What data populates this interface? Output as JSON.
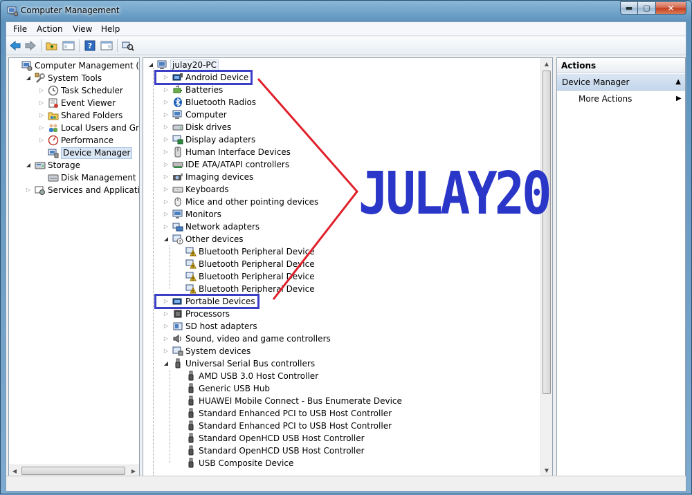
{
  "window": {
    "title": "Computer Management",
    "caption_min": "▬",
    "caption_max": "▢",
    "caption_close": "✕"
  },
  "menu": [
    "File",
    "Action",
    "View",
    "Help"
  ],
  "left_tree": [
    {
      "label": "Computer Management (Local",
      "icon": "computer-management-icon",
      "expander": ""
    },
    {
      "label": "System Tools",
      "icon": "system-tools-icon",
      "expander": "open"
    },
    {
      "label": "Task Scheduler",
      "icon": "clock-icon",
      "expander": "closed"
    },
    {
      "label": "Event Viewer",
      "icon": "event-viewer-icon",
      "expander": "closed"
    },
    {
      "label": "Shared Folders",
      "icon": "shared-folders-icon",
      "expander": "closed"
    },
    {
      "label": "Local Users and Groups",
      "icon": "users-icon",
      "expander": "closed"
    },
    {
      "label": "Performance",
      "icon": "performance-icon",
      "expander": "closed"
    },
    {
      "label": "Device Manager",
      "icon": "device-manager-icon",
      "expander": "",
      "selected": true
    },
    {
      "label": "Storage",
      "icon": "storage-icon",
      "expander": "open"
    },
    {
      "label": "Disk Management",
      "icon": "disk-management-icon",
      "expander": ""
    },
    {
      "label": "Services and Applications",
      "icon": "services-icon",
      "expander": "closed"
    }
  ],
  "device_tree": {
    "root": "julay20-PC",
    "items": [
      {
        "label": "Android Device",
        "icon": "android-device-icon",
        "level": 1,
        "expander": "closed"
      },
      {
        "label": "Batteries",
        "icon": "battery-icon",
        "level": 1,
        "expander": "closed"
      },
      {
        "label": "Bluetooth Radios",
        "icon": "bluetooth-icon",
        "level": 1,
        "expander": "closed"
      },
      {
        "label": "Computer",
        "icon": "computer-icon",
        "level": 1,
        "expander": "closed"
      },
      {
        "label": "Disk drives",
        "icon": "disk-drive-icon",
        "level": 1,
        "expander": "closed"
      },
      {
        "label": "Display adapters",
        "icon": "display-adapter-icon",
        "level": 1,
        "expander": "closed"
      },
      {
        "label": "Human Interface Devices",
        "icon": "hid-icon",
        "level": 1,
        "expander": "closed"
      },
      {
        "label": "IDE ATA/ATAPI controllers",
        "icon": "ide-controller-icon",
        "level": 1,
        "expander": "closed"
      },
      {
        "label": "Imaging devices",
        "icon": "camera-icon",
        "level": 1,
        "expander": "closed"
      },
      {
        "label": "Keyboards",
        "icon": "keyboard-icon",
        "level": 1,
        "expander": "closed"
      },
      {
        "label": "Mice and other pointing devices",
        "icon": "mouse-icon",
        "level": 1,
        "expander": "closed"
      },
      {
        "label": "Monitors",
        "icon": "monitor-icon",
        "level": 1,
        "expander": "closed"
      },
      {
        "label": "Network adapters",
        "icon": "network-adapter-icon",
        "level": 1,
        "expander": "closed"
      },
      {
        "label": "Other devices",
        "icon": "other-devices-icon",
        "level": 1,
        "expander": "open"
      },
      {
        "label": "Bluetooth Peripheral Device",
        "icon": "warning-device-icon",
        "level": 2,
        "expander": ""
      },
      {
        "label": "Bluetooth Peripheral Device",
        "icon": "warning-device-icon",
        "level": 2,
        "expander": ""
      },
      {
        "label": "Bluetooth Peripheral Device",
        "icon": "warning-device-icon",
        "level": 2,
        "expander": ""
      },
      {
        "label": "Bluetooth Peripheral Device",
        "icon": "warning-device-icon",
        "level": 2,
        "expander": ""
      },
      {
        "label": "Portable Devices",
        "icon": "portable-device-icon",
        "level": 1,
        "expander": "closed"
      },
      {
        "label": "Processors",
        "icon": "processor-icon",
        "level": 1,
        "expander": "closed"
      },
      {
        "label": "SD host adapters",
        "icon": "sd-adapter-icon",
        "level": 1,
        "expander": "closed"
      },
      {
        "label": "Sound, video and game controllers",
        "icon": "sound-icon",
        "level": 1,
        "expander": "closed"
      },
      {
        "label": "System devices",
        "icon": "system-devices-icon",
        "level": 1,
        "expander": "closed"
      },
      {
        "label": "Universal Serial Bus controllers",
        "icon": "usb-icon",
        "level": 1,
        "expander": "open"
      },
      {
        "label": "AMD USB 3.0 Host Controller",
        "icon": "usb-plug-icon",
        "level": 2,
        "expander": ""
      },
      {
        "label": "Generic USB Hub",
        "icon": "usb-plug-icon",
        "level": 2,
        "expander": ""
      },
      {
        "label": "HUAWEI Mobile Connect - Bus Enumerate Device",
        "icon": "usb-plug-icon",
        "level": 2,
        "expander": ""
      },
      {
        "label": "Standard Enhanced PCI to USB Host Controller",
        "icon": "usb-plug-icon",
        "level": 2,
        "expander": ""
      },
      {
        "label": "Standard Enhanced PCI to USB Host Controller",
        "icon": "usb-plug-icon",
        "level": 2,
        "expander": ""
      },
      {
        "label": "Standard OpenHCD USB Host Controller",
        "icon": "usb-plug-icon",
        "level": 2,
        "expander": ""
      },
      {
        "label": "Standard OpenHCD USB Host Controller",
        "icon": "usb-plug-icon",
        "level": 2,
        "expander": ""
      },
      {
        "label": "USB Composite Device",
        "icon": "usb-plug-icon",
        "level": 2,
        "expander": ""
      }
    ]
  },
  "actions": {
    "header": "Actions",
    "section": "Device Manager",
    "items": [
      "More Actions"
    ]
  },
  "overlay": {
    "watermark": "JULAY20",
    "box_color": "#3b3fc6",
    "arrow_color": "#e0202a"
  }
}
